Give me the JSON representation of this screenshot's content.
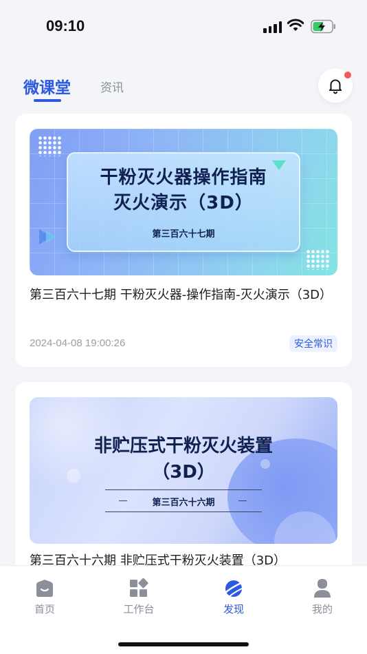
{
  "status_bar": {
    "time": "09:10"
  },
  "top_tabs": {
    "active": "微课堂",
    "inactive": "资讯"
  },
  "cards": [
    {
      "cover_line1": "干粉灭火器操作指南",
      "cover_line2": "灭火演示（3D）",
      "cover_issue": "第三百六十七期",
      "title": "第三百六十七期 干粉灭火器-操作指南-灭火演示（3D）",
      "date": "2024-04-08 19:00:26",
      "tag": "安全常识"
    },
    {
      "cover_line1": "非贮压式干粉灭火装置",
      "cover_line2": "（3D）",
      "cover_issue": "第三百六十六期",
      "title": "第三百六十六期 非贮压式干粉灭火装置（3D）"
    }
  ],
  "bottom_nav": {
    "home": "首页",
    "workbench": "工作台",
    "discover": "发现",
    "mine": "我的"
  },
  "colors": {
    "accent": "#2c59e0",
    "badge": "#f25a5a"
  }
}
